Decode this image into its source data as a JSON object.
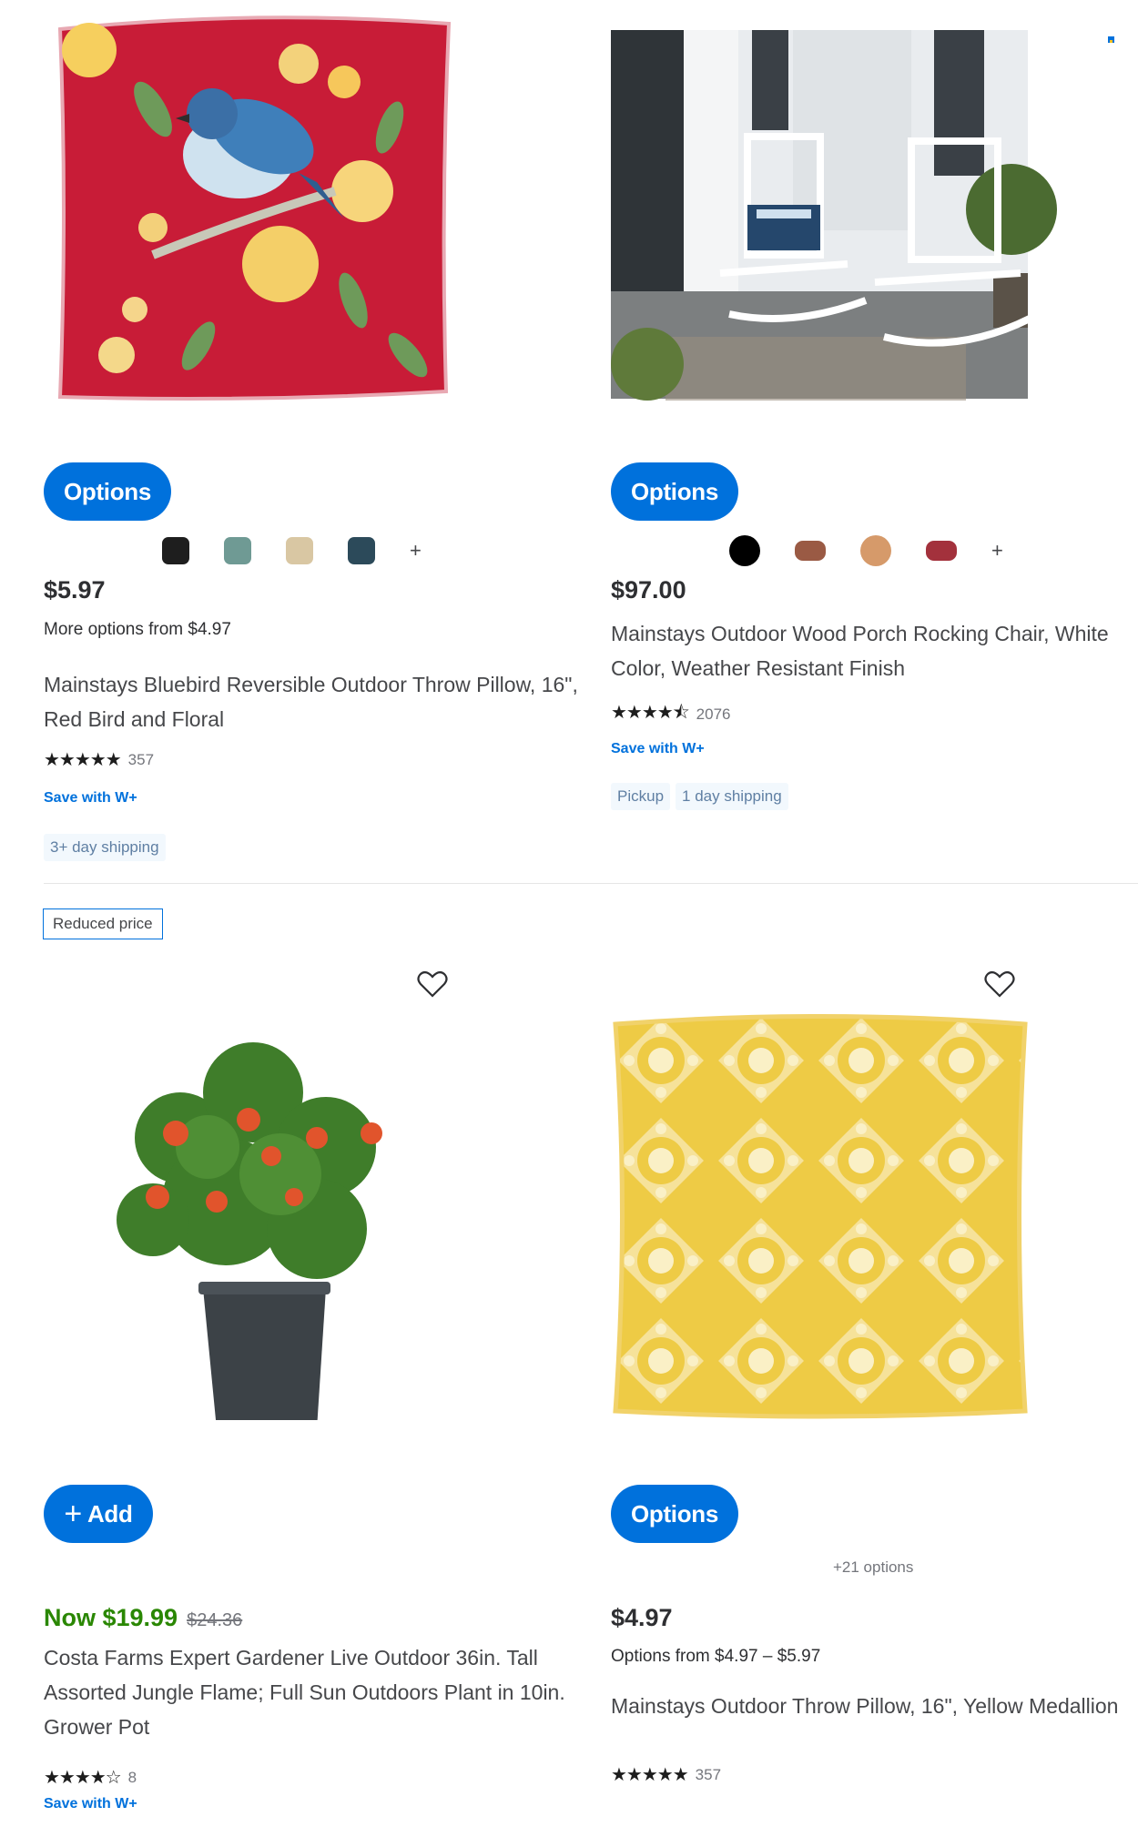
{
  "products": [
    {
      "button": "Options",
      "price": "$5.97",
      "sub": "More options from $4.97",
      "title": "Mainstays Bluebird Reversible Outdoor Throw Pillow, 16\", Red Bird and Floral",
      "stars": "★★★★★",
      "count": "357",
      "wplus": "Save with W+",
      "tags": [
        "3+ day shipping"
      ],
      "swatch_colors": [
        "#1e1e1e",
        "#6f9a94",
        "#d9c7a3",
        "#2c4a5a"
      ],
      "swatch_more": "+"
    },
    {
      "button": "Options",
      "price": "$97.00",
      "title": "Mainstays Outdoor Wood Porch Rocking Chair, White Color, Weather Resistant Finish",
      "stars": "★★★★⯪",
      "count": "2076",
      "wplus": "Save with W+",
      "tags": [
        "Pickup",
        "1 day shipping"
      ],
      "swatch_colors": [
        "#000000",
        "#9a5a44",
        "#d69a6a",
        "#a3313c"
      ],
      "swatch_more": "+"
    },
    {
      "badge": "Reduced price",
      "button": "Add",
      "button_icon": "+",
      "price_now": "Now $19.99",
      "price_was": "$24.36",
      "title": "Costa Farms Expert Gardener Live Outdoor 36in. Tall Assorted Jungle Flame; Full Sun Outdoors Plant in 10in. Grower Pot",
      "stars": "★★★★☆",
      "count": "8",
      "wplus": "Save with W+"
    },
    {
      "button": "Options",
      "options_count": "+21 options",
      "price": "$4.97",
      "sub": "Options from $4.97 – $5.97",
      "title": "Mainstays Outdoor Throw Pillow, 16\", Yellow Medallion",
      "stars": "★★★★★",
      "count": "357"
    }
  ],
  "colors": {
    "accent": "#0071dc",
    "sale_green": "#2a8703"
  }
}
